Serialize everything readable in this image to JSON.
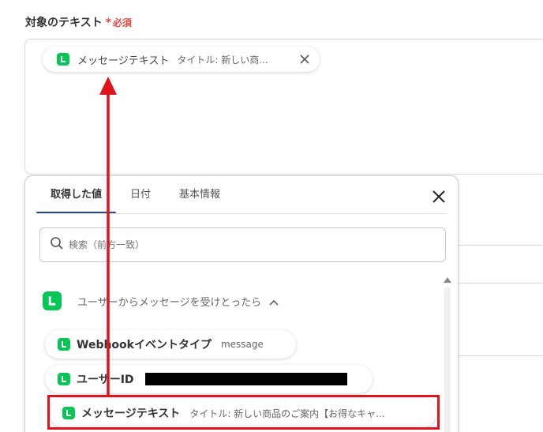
{
  "field": {
    "label": "対象のテキスト",
    "required_mark": "*",
    "required_text": "必須"
  },
  "selected_chip": {
    "label": "メッセージテキスト",
    "value": "タイトル: 新しい商..."
  },
  "panel": {
    "tabs": [
      {
        "label": "取得した値",
        "active": true
      },
      {
        "label": "日付",
        "active": false
      },
      {
        "label": "基本情報",
        "active": false
      }
    ],
    "search_placeholder": "検索（前方一致）",
    "group": {
      "label": "ユーザーからメッセージを受けとったら",
      "expanded": true,
      "items": [
        {
          "label": "Webhookイベントタイプ",
          "value": "message"
        },
        {
          "label": "ユーザーID",
          "value": "",
          "redacted": true
        },
        {
          "label": "メッセージテキスト",
          "value": "タイトル: 新しい商品のご案内【お得なキャ..."
        }
      ]
    }
  },
  "colors": {
    "line_green": "#06c755",
    "required_red": "#e8483f",
    "highlight_red": "#e0121c",
    "tab_underline": "#2d4a7a"
  },
  "icons": {
    "chip_icon": "line-icon",
    "close": "close-icon",
    "search": "search-icon",
    "collapse": "chevron-up-icon"
  }
}
